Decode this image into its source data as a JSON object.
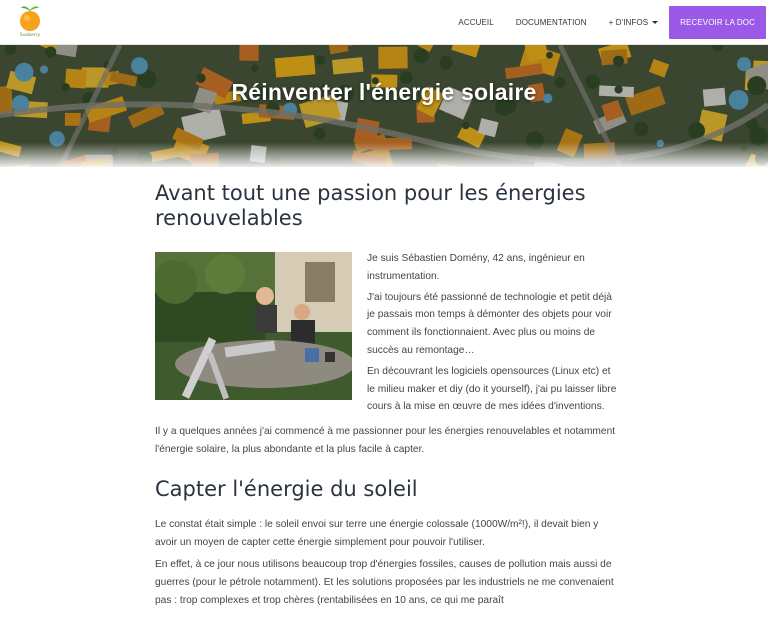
{
  "brand": {
    "name": "Sunberry",
    "logo_icon": "orange-fruit-logo"
  },
  "nav": {
    "items": [
      {
        "label": "ACCUEIL"
      },
      {
        "label": "DOCUMENTATION"
      },
      {
        "label": "+ D'INFOS"
      }
    ],
    "cta_label": "RECEVOIR LA DOC",
    "cta_color": "#9b59e8"
  },
  "hero": {
    "title": "Réinventer l'énergie solaire",
    "image": "aerial-view-of-solar-rooftops"
  },
  "section1": {
    "heading": "Avant tout une passion pour les énergies renouvelables",
    "photo": "two-men-at-table-with-solar-equipment",
    "paragraphs": [
      "Je suis Sébastien Domény, 42 ans, ingénieur en instrumentation.",
      "J'ai toujours été passionné de technologie et petit déjà je passais mon temps à démonter des objets pour voir comment ils fonctionnaient. Avec plus ou moins de succès au remontage…",
      "En découvrant les logiciels opensources (Linux etc) et le milieu maker et diy (do it yourself), j'ai pu laisser libre cours à la mise en œuvre de mes idées d'inventions."
    ],
    "after": "Il y a quelques années j'ai commencé à me passionner pour les énergies renouvelables et notamment l'énergie solaire, la plus abondante et la plus facile à capter."
  },
  "section2": {
    "heading": "Capter l'énergie du soleil",
    "paragraphs": [
      "Le constat était simple : le soleil envoi sur terre une énergie colossale (1000W/m²!), il devait bien y avoir un moyen de capter cette énergie simplement pour pouvoir l'utiliser.",
      "En effet, à ce jour nous utilisons beaucoup trop d'énergies fossiles, causes de pollution mais aussi de guerres (pour le pétrole notamment). Et les solutions proposées par les industriels ne me convenaient pas : trop complexes et trop chères (rentabilisées en 10 ans, ce qui me paraît"
    ]
  }
}
